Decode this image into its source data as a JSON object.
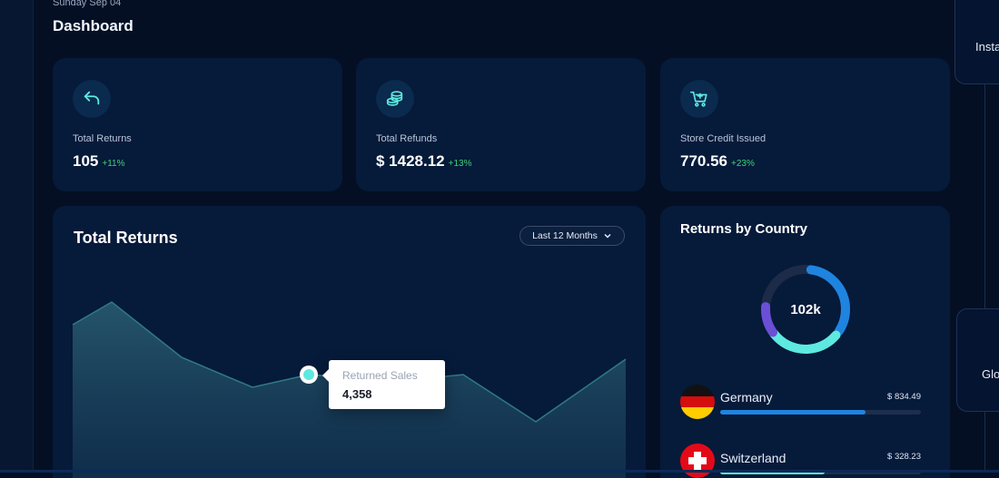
{
  "header": {
    "date": "Sunday Sep 04",
    "title": "Dashboard"
  },
  "stats": [
    {
      "label": "Total Returns",
      "value": "105",
      "delta": "+11%",
      "icon": "return-arrow-icon"
    },
    {
      "label": "Total Refunds",
      "value": "$ 1428.12",
      "delta": "+13%",
      "icon": "coins-icon"
    },
    {
      "label": "Store Credit Issued",
      "value": "770.56",
      "delta": "+23%",
      "icon": "cart-icon"
    }
  ],
  "returns_chart": {
    "title": "Total Returns",
    "range_label": "Last 12 Months",
    "tooltip": {
      "label": "Returned Sales",
      "value": "4,358"
    }
  },
  "country": {
    "title": "Returns by Country",
    "total": "102k",
    "items": [
      {
        "name": "Germany",
        "amount": "$ 834.49",
        "share": 0.73
      },
      {
        "name": "Switzerland",
        "amount": "$ 328.23",
        "share": 0.52
      }
    ]
  },
  "side_panel": {
    "item1": "Insta",
    "item2": "Glo"
  },
  "colors": {
    "accent": "#1f84e0",
    "teal": "#5ee9e0",
    "purple": "#6b4fd6",
    "positive": "#3fd17a"
  }
}
